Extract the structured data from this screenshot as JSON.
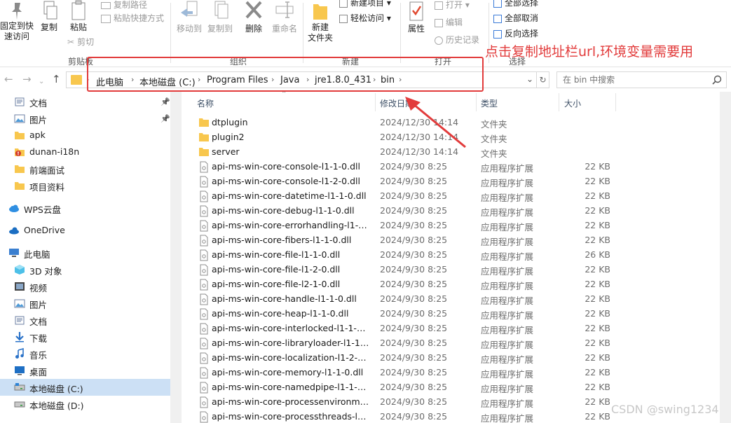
{
  "ribbon": {
    "pin_quick_access": [
      "固定到快",
      "速访问"
    ],
    "copy": "复制",
    "paste": "粘贴",
    "copy_path": "复制路径",
    "paste_shortcut": "粘贴快捷方式",
    "cut": "剪切",
    "move_to": "移动到",
    "copy_to": "复制到",
    "delete": "删除",
    "rename": "重命名",
    "new_folder": [
      "新建",
      "文件夹"
    ],
    "new_item": "新建项目 ▾",
    "easy_access": "轻松访问 ▾",
    "properties": "属性",
    "open": "打开 ▾",
    "edit": "编辑",
    "history": "历史记录",
    "select_all": "全部选择",
    "select_none": "全部取消",
    "invert_selection": "反向选择",
    "groups": {
      "clipboard": "剪贴板",
      "organize": "组织",
      "new": "新建",
      "open": "打开",
      "select": "选择"
    }
  },
  "address": {
    "crumbs": [
      "此电脑",
      "本地磁盘 (C:)",
      "Program Files",
      "Java",
      "jre1.8.0_431",
      "bin"
    ]
  },
  "search": {
    "placeholder": "在 bin 中搜索"
  },
  "nav": {
    "items": [
      {
        "label": "文档",
        "icon": "documents-icon",
        "pinned": true
      },
      {
        "label": "图片",
        "icon": "pictures-icon",
        "pinned": true
      },
      {
        "label": "apk",
        "icon": "folder-icon"
      },
      {
        "label": "dunan-i18n",
        "icon": "folder-error-icon"
      },
      {
        "label": "前端面试",
        "icon": "folder-icon"
      },
      {
        "label": "项目资料",
        "icon": "folder-icon"
      },
      {
        "label": "WPS云盘",
        "icon": "cloud-icon"
      },
      {
        "label": "OneDrive",
        "icon": "onedrive-icon"
      },
      {
        "label": "此电脑",
        "icon": "computer-icon"
      },
      {
        "label": "3D 对象",
        "icon": "cube-3d-icon"
      },
      {
        "label": "视频",
        "icon": "video-icon"
      },
      {
        "label": "图片",
        "icon": "pictures-icon"
      },
      {
        "label": "文档",
        "icon": "documents-icon"
      },
      {
        "label": "下载",
        "icon": "download-icon"
      },
      {
        "label": "音乐",
        "icon": "music-icon"
      },
      {
        "label": "桌面",
        "icon": "desktop-icon"
      },
      {
        "label": "本地磁盘 (C:)",
        "icon": "drive-c-icon",
        "selected": true
      },
      {
        "label": "本地磁盘 (D:)",
        "icon": "drive-icon"
      }
    ]
  },
  "columns": {
    "name": "名称",
    "date": "修改日期",
    "type": "类型",
    "size": "大小"
  },
  "files": [
    {
      "name": "dtplugin",
      "date": "2024/12/30 14:14",
      "type": "文件夹",
      "size": "",
      "folder": true
    },
    {
      "name": "plugin2",
      "date": "2024/12/30 14:14",
      "type": "文件夹",
      "size": "",
      "folder": true
    },
    {
      "name": "server",
      "date": "2024/12/30 14:14",
      "type": "文件夹",
      "size": "",
      "folder": true
    },
    {
      "name": "api-ms-win-core-console-l1-1-0.dll",
      "date": "2024/9/30 8:25",
      "type": "应用程序扩展",
      "size": "22 KB"
    },
    {
      "name": "api-ms-win-core-console-l1-2-0.dll",
      "date": "2024/9/30 8:25",
      "type": "应用程序扩展",
      "size": "22 KB"
    },
    {
      "name": "api-ms-win-core-datetime-l1-1-0.dll",
      "date": "2024/9/30 8:25",
      "type": "应用程序扩展",
      "size": "22 KB"
    },
    {
      "name": "api-ms-win-core-debug-l1-1-0.dll",
      "date": "2024/9/30 8:25",
      "type": "应用程序扩展",
      "size": "22 KB"
    },
    {
      "name": "api-ms-win-core-errorhandling-l1-1-...",
      "date": "2024/9/30 8:25",
      "type": "应用程序扩展",
      "size": "22 KB"
    },
    {
      "name": "api-ms-win-core-fibers-l1-1-0.dll",
      "date": "2024/9/30 8:25",
      "type": "应用程序扩展",
      "size": "22 KB"
    },
    {
      "name": "api-ms-win-core-file-l1-1-0.dll",
      "date": "2024/9/30 8:25",
      "type": "应用程序扩展",
      "size": "26 KB"
    },
    {
      "name": "api-ms-win-core-file-l1-2-0.dll",
      "date": "2024/9/30 8:25",
      "type": "应用程序扩展",
      "size": "22 KB"
    },
    {
      "name": "api-ms-win-core-file-l2-1-0.dll",
      "date": "2024/9/30 8:25",
      "type": "应用程序扩展",
      "size": "22 KB"
    },
    {
      "name": "api-ms-win-core-handle-l1-1-0.dll",
      "date": "2024/9/30 8:25",
      "type": "应用程序扩展",
      "size": "22 KB"
    },
    {
      "name": "api-ms-win-core-heap-l1-1-0.dll",
      "date": "2024/9/30 8:25",
      "type": "应用程序扩展",
      "size": "22 KB"
    },
    {
      "name": "api-ms-win-core-interlocked-l1-1-0.dll",
      "date": "2024/9/30 8:25",
      "type": "应用程序扩展",
      "size": "22 KB"
    },
    {
      "name": "api-ms-win-core-libraryloader-l1-1-0....",
      "date": "2024/9/30 8:25",
      "type": "应用程序扩展",
      "size": "22 KB"
    },
    {
      "name": "api-ms-win-core-localization-l1-2-0.dll",
      "date": "2024/9/30 8:25",
      "type": "应用程序扩展",
      "size": "22 KB"
    },
    {
      "name": "api-ms-win-core-memory-l1-1-0.dll",
      "date": "2024/9/30 8:25",
      "type": "应用程序扩展",
      "size": "22 KB"
    },
    {
      "name": "api-ms-win-core-namedpipe-l1-1-0.dll",
      "date": "2024/9/30 8:25",
      "type": "应用程序扩展",
      "size": "22 KB"
    },
    {
      "name": "api-ms-win-core-processenvironmen...",
      "date": "2024/9/30 8:25",
      "type": "应用程序扩展",
      "size": "22 KB"
    },
    {
      "name": "api-ms-win-core-processthreads-l1-1...",
      "date": "2024/9/30 8:25",
      "type": "应用程序扩展",
      "size": "22 KB"
    }
  ],
  "annotation": {
    "text": "点击复制地址栏url,环境变量需要用"
  },
  "watermark": "CSDN @swing1234",
  "colors": {
    "accent": "#e23b3b",
    "selection": "#cce0f5",
    "folder": "#f8c74e"
  }
}
